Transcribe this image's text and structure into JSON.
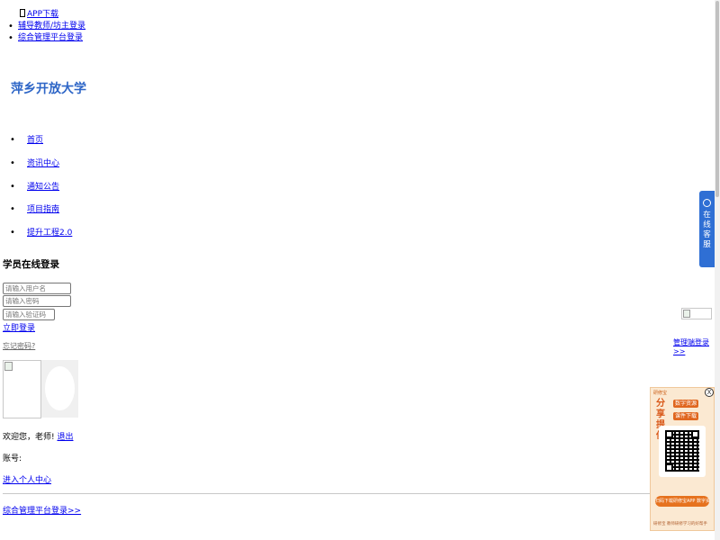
{
  "topbar": {
    "app_download": "APP下载",
    "tutor_login": "辅导教师/坊主登录",
    "platform_login": "综合管理平台登录"
  },
  "site": {
    "title": "萍乡开放大学"
  },
  "nav": {
    "items": [
      {
        "label": "首页"
      },
      {
        "label": "资讯中心"
      },
      {
        "label": "通知公告"
      },
      {
        "label": "项目指南"
      },
      {
        "label": "提升工程2.0"
      }
    ]
  },
  "login": {
    "title": "学员在线登录",
    "username_placeholder": "请输入用户名",
    "password_placeholder": "请输入密码",
    "captcha_placeholder": "请输入验证码",
    "submit_label": "立即登录",
    "forgot_label": "忘记密码?"
  },
  "profile": {
    "welcome_text": "欢迎您，老师!",
    "logout_label": "退出",
    "account_label": "账号:",
    "center_link": "进入个人中心",
    "platform_link": "综合管理平台登录>>"
  },
  "admin": {
    "login_link": "管理端登录>>"
  },
  "service": {
    "label": "在线客服"
  },
  "promo": {
    "brand": "研修宝",
    "headline": "分享提供",
    "tag1": "数字资源",
    "tag2": "课件下载",
    "cta": "扫码下载研修宝APP 数字资源一键下载",
    "footer": "研修宝 教师研修学习的好帮手",
    "close": "X"
  },
  "colors": {
    "link": "#0000ee",
    "title_blue": "#2e66c7",
    "service_blue": "#2f6fd4",
    "promo_orange": "#e6721e"
  }
}
